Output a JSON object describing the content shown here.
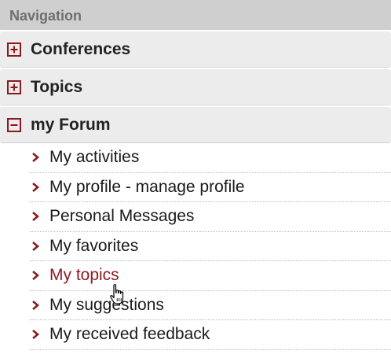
{
  "navigation": {
    "title": "Navigation",
    "sections": [
      {
        "label": "Conferences",
        "icon": "plus-box-icon",
        "expanded": false
      },
      {
        "label": "Topics",
        "icon": "plus-box-icon",
        "expanded": false
      },
      {
        "label": "my Forum",
        "icon": "minus-box-icon",
        "expanded": true
      }
    ],
    "forum_links": [
      {
        "label": "My activities",
        "icon": "chevron-right-icon"
      },
      {
        "label": "My profile - manage profile",
        "icon": "chevron-right-icon"
      },
      {
        "label": "Personal Messages",
        "icon": "chevron-right-icon"
      },
      {
        "label": "My favorites",
        "icon": "chevron-right-icon"
      },
      {
        "label": "My topics",
        "icon": "chevron-right-icon",
        "hovered": true
      },
      {
        "label": "My suggestions",
        "icon": "chevron-right-icon"
      },
      {
        "label": "My received feedback",
        "icon": "chevron-right-icon"
      }
    ]
  },
  "colors": {
    "accent": "#8b1a1f",
    "header_bg": "#cfcfcf",
    "section_bg": "#ececec",
    "text": "#222222",
    "header_text": "#6e6e6e"
  }
}
